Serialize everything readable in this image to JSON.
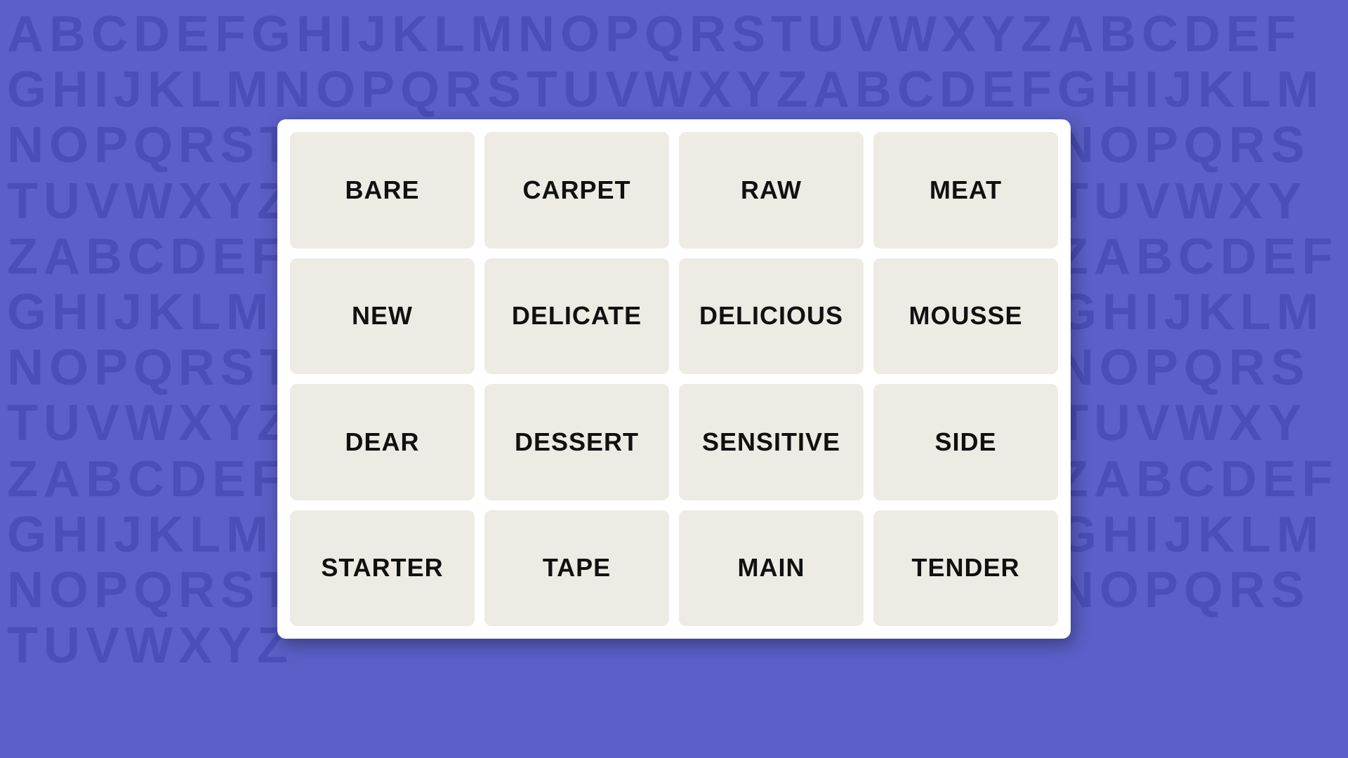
{
  "background": {
    "letters": "ABCDEFGHIJKLMNOPQRSTUVWXYZABCDEFGHIJKLMNOPQRSTUVWXYZABCDEFGHIJKLMNOPQRSTUVWXYZABCDEFGHIJKLMNOPQRSTUVWXYZABCDEFGHIJKLMNOPQRSTUVWXYZABCDEFGHIJKLMNOPQRSTUVWXYZABCDEFGHIJKLMNOPQRSTUVWXYZABCDEFGHIJKLMNOPQRSTUVWXYZABCDEFGHIJKLMNOPQRSTUVWXYZABCDEFGHIJKLMNOPQRSTUVWXYZABCDEFGHIJKLMNOPQRSTUVWXYZABCDEFGHIJKLMNOPQRSTUVWXYZABCDEFGHIJKLMNOPQRSTUVWXYZABCDEFGHIJKLMNOPQRSTUVWXYZ"
  },
  "grid": {
    "tiles": [
      {
        "id": 0,
        "label": "BARE"
      },
      {
        "id": 1,
        "label": "CARPET"
      },
      {
        "id": 2,
        "label": "RAW"
      },
      {
        "id": 3,
        "label": "MEAT"
      },
      {
        "id": 4,
        "label": "NEW"
      },
      {
        "id": 5,
        "label": "DELICATE"
      },
      {
        "id": 6,
        "label": "DELICIOUS"
      },
      {
        "id": 7,
        "label": "MOUSSE"
      },
      {
        "id": 8,
        "label": "DEAR"
      },
      {
        "id": 9,
        "label": "DESSERT"
      },
      {
        "id": 10,
        "label": "SENSITIVE"
      },
      {
        "id": 11,
        "label": "SIDE"
      },
      {
        "id": 12,
        "label": "STARTER"
      },
      {
        "id": 13,
        "label": "TAPE"
      },
      {
        "id": 14,
        "label": "MAIN"
      },
      {
        "id": 15,
        "label": "TENDER"
      }
    ]
  }
}
